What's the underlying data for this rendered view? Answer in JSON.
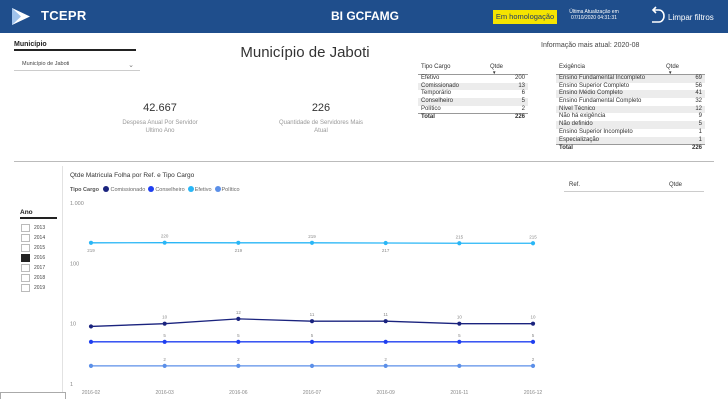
{
  "header": {
    "brand": "TCEPR",
    "app_title": "BI GCFAMG",
    "env_badge": "Em homologação",
    "update_line1": "Última Atualização em",
    "update_line2": "07/10/2020 04:31:31",
    "clear_filters": "Limpar filtros",
    "colors": {
      "bar": "#1f4e8c",
      "badge": "#f5e400"
    }
  },
  "filters": {
    "municipio_label": "Município",
    "municipio_value": "Município de Jaboti",
    "ano_label": "Ano",
    "years": [
      {
        "label": "2013",
        "checked": false
      },
      {
        "label": "2014",
        "checked": false
      },
      {
        "label": "2015",
        "checked": false
      },
      {
        "label": "2016",
        "checked": true
      },
      {
        "label": "2017",
        "checked": false
      },
      {
        "label": "2018",
        "checked": false
      },
      {
        "label": "2019",
        "checked": false
      }
    ]
  },
  "page_title": "Município de Jaboti",
  "kpis": [
    {
      "value": "42.667",
      "label_line1": "Despesa Anual Por Servidor",
      "label_line2": "Ultimo Ano"
    },
    {
      "value": "226",
      "label_line1": "Quantidade de Servidores Mais",
      "label_line2": "Atual"
    }
  ],
  "latest_info": "Informação mais atual: 2020-08",
  "tipo_cargo_table": {
    "headers": [
      "Tipo Cargo",
      "Qtde"
    ],
    "rows": [
      {
        "name": "Efetivo",
        "qtde": "200"
      },
      {
        "name": "Comissionado",
        "qtde": "13"
      },
      {
        "name": "Temporário",
        "qtde": "6"
      },
      {
        "name": "Conselheiro",
        "qtde": "5"
      },
      {
        "name": "Político",
        "qtde": "2"
      }
    ],
    "total_label": "Total",
    "total_value": "226"
  },
  "exigencia_table": {
    "headers": [
      "Exigência",
      "Qtde"
    ],
    "rows": [
      {
        "name": "Ensino Fundamental Incompleto",
        "qtde": "69"
      },
      {
        "name": "Ensino Superior Completo",
        "qtde": "56"
      },
      {
        "name": "Ensino Médio Completo",
        "qtde": "41"
      },
      {
        "name": "Ensino Fundamental Completo",
        "qtde": "32"
      },
      {
        "name": "Nível Técnico",
        "qtde": "12"
      },
      {
        "name": "Não há exigência",
        "qtde": "9"
      },
      {
        "name": "Não definido",
        "qtde": "5"
      },
      {
        "name": "Ensino Superior Incompleto",
        "qtde": "1"
      },
      {
        "name": "Especialização",
        "qtde": "1"
      }
    ],
    "total_label": "Total",
    "total_value": "226"
  },
  "ref_table": {
    "headers": [
      "Ref.",
      "Qtde"
    ]
  },
  "chart_data": {
    "type": "line",
    "title": "Qtde Matricula Folha por Ref. e Tipo Cargo",
    "legend_title": "Tipo Cargo",
    "x": [
      "2016-02",
      "2016-03",
      "2016-04",
      "2016-05",
      "2016-06",
      "2016-07",
      "2016-08",
      "2016-09",
      "2016-10",
      "2016-11",
      "2016-12"
    ],
    "x_tick_labels": [
      "2016-02",
      "2016-03",
      "2016-06",
      "2016-07",
      "2016-09",
      "2016-11",
      "2016-12"
    ],
    "y_scale": "log",
    "y_ticks": [
      "1",
      "10",
      "100",
      "1.000"
    ],
    "ylim": [
      1,
      1000
    ],
    "series": [
      {
        "name": "Comissionado",
        "color": "#1a237e",
        "values": [
          9,
          10,
          12,
          11,
          11,
          10,
          10
        ],
        "labels": [
          "",
          "10",
          "12",
          "11",
          "11",
          "10",
          "10"
        ]
      },
      {
        "name": "Conselheiro",
        "color": "#1f3ff0",
        "values": [
          5,
          5,
          5,
          5,
          5,
          5,
          5
        ],
        "labels": [
          "",
          "5",
          "5",
          "5",
          "",
          "5",
          "5"
        ]
      },
      {
        "name": "Efetivo",
        "color": "#29b6f6",
        "values": [
          219,
          220,
          219,
          219,
          217,
          215,
          215
        ],
        "labels": [
          "219",
          "220",
          "219",
          "219",
          "217",
          "215",
          "215"
        ]
      },
      {
        "name": "Político",
        "color": "#5b8fe8",
        "values": [
          2,
          2,
          2,
          2,
          2,
          2,
          2
        ],
        "labels": [
          "",
          "2",
          "2",
          "",
          "2",
          "",
          "2"
        ]
      }
    ],
    "grid": false,
    "legend_position": "top-left"
  }
}
